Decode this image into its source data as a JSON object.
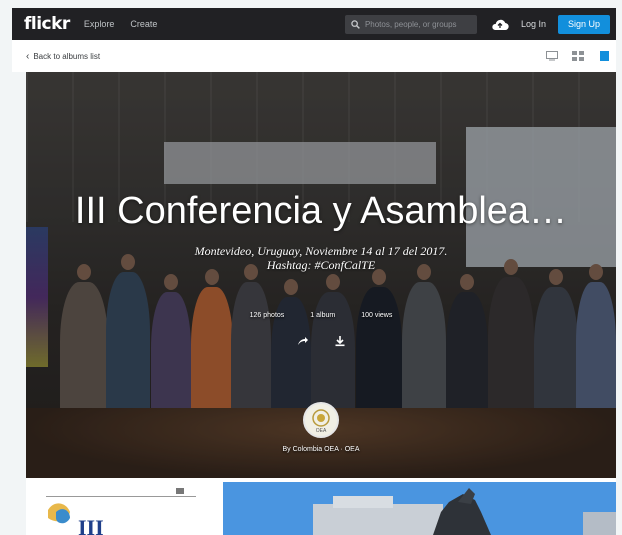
{
  "topbar": {
    "logo": "flickr",
    "nav": [
      "Explore",
      "Create"
    ],
    "search_placeholder": "Photos, people, or groups",
    "login_label": "Log In",
    "signup_label": "Sign Up"
  },
  "subbar": {
    "back_label": "Back to albums list"
  },
  "album": {
    "title": "III Conferencia y Asamblea…",
    "description_line1": "Montevideo, Uruguay, Noviembre 14 al 17 del 2017.",
    "description_line2": "Hashtag: #ConfCalTE",
    "stats": [
      "126 photos",
      "1 album",
      "100 views"
    ],
    "byline": "By Colombia OEA · OEA",
    "avatar_text": "OEA"
  },
  "colors": {
    "topbar": "#212124",
    "accent": "#128fdc",
    "page_bg": "#f2f5f6"
  },
  "icons": [
    "search-icon",
    "upload-cloud-icon",
    "chevron-left-icon",
    "slideshow-view-icon",
    "grid-view-icon",
    "share-icon",
    "download-icon"
  ]
}
